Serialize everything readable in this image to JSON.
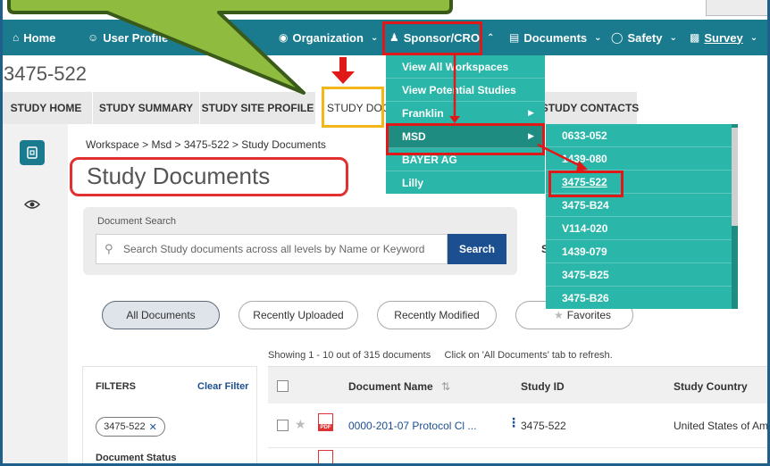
{
  "nav": {
    "home": "Home",
    "user_profile": "User Profile",
    "organization": "Organization",
    "sponsor_cro": "Sponsor/CRO",
    "documents": "Documents",
    "safety": "Safety",
    "survey": "Survey"
  },
  "study_code": "3475-522",
  "tabs": [
    "STUDY HOME",
    "STUDY SUMMARY",
    "STUDY SITE PROFILE",
    "STUDY DOC",
    "STUDY CONTACTS"
  ],
  "breadcrumb": "Workspace > Msd > 3475-522 > Study Documents",
  "heading": "Study Documents",
  "search": {
    "label": "Document Search",
    "placeholder": "Search Study documents across all levels by Name or Keyword",
    "button": "Search",
    "stray_text": "S"
  },
  "pills": [
    "All Documents",
    "Recently Uploaded",
    "Recently Modified",
    "Favorites"
  ],
  "showing": "Showing 1 - 10 out of 315 documents     Click on 'All Documents' tab to refresh.",
  "filters": {
    "title": "FILTERS",
    "clear": "Clear Filter",
    "chip": "3475-522",
    "chip_x": "✕",
    "status": "Document Status"
  },
  "table": {
    "columns": [
      "Document Name",
      "Study ID",
      "Study Country"
    ],
    "rows": [
      {
        "name": "0000-201-07 Protocol Cl ...",
        "study_id": "3475-522",
        "country": "United States of Am"
      }
    ]
  },
  "sponsor_menu": [
    "View All Workspaces",
    "View Potential Studies",
    "Franklin",
    "MSD",
    "BAYER AG",
    "Lilly"
  ],
  "msd_menu": [
    "0633-052",
    "1439-080",
    "3475-522",
    "3475-B24",
    "V114-020",
    "1439-079",
    "3475-B25",
    "3475-B26"
  ],
  "colors": {
    "nav_bg": "#1a7b8e",
    "menu_bg": "#2ab6a8",
    "highlight_red": "#e01818",
    "highlight_yellow": "#f2b51a",
    "callout_green": "#8fbc3e",
    "callout_border": "#3a5a1a",
    "primary_button": "#1c4f8f"
  }
}
